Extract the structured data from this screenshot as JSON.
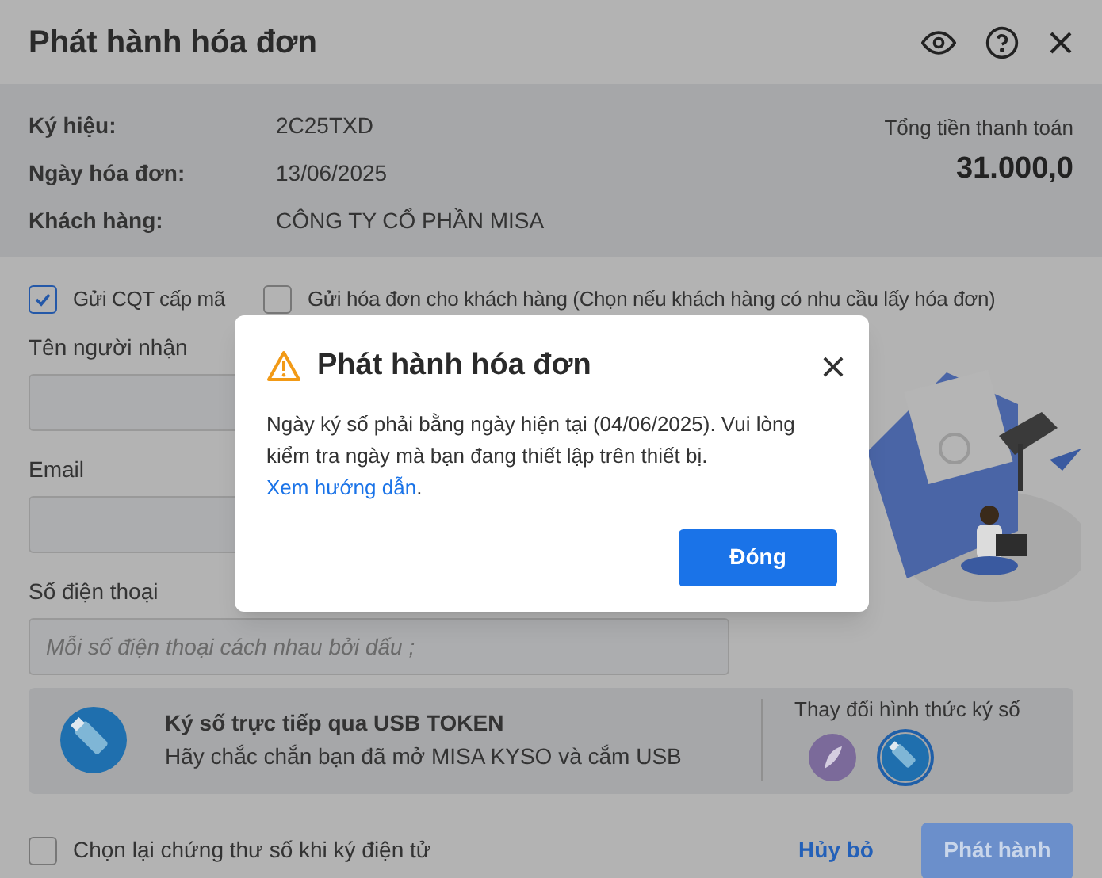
{
  "window": {
    "title": "Phát hành hóa đơn"
  },
  "info": {
    "rows": [
      {
        "label": "Ký hiệu:",
        "value": "2C25TXD"
      },
      {
        "label": "Ngày hóa đơn:",
        "value": "13/06/2025"
      },
      {
        "label": "Khách hàng:",
        "value": "CÔNG TY CỔ PHẦN MISA"
      }
    ],
    "total_label": "Tổng tiền thanh toán",
    "total_value": "31.000,0"
  },
  "options": [
    {
      "label": "Gửi CQT cấp mã",
      "checked": true
    },
    {
      "label": "Gửi hóa đơn cho khách hàng (Chọn nếu khách hàng có nhu cầu lấy hóa đơn)",
      "checked": false
    }
  ],
  "fields": [
    {
      "label": "Tên người nhận"
    },
    {
      "label": "Email"
    },
    {
      "label": "Số điện thoại",
      "placeholder": "Mỗi số điện thoại cách nhau bởi dấu ;"
    }
  ],
  "signing": {
    "title": "Ký số trực tiếp qua USB TOKEN",
    "subtitle": "Hãy chắc chắn bạn đã mở MISA KYSO và cắm USB",
    "change_label": "Thay đổi hình thức ký số",
    "methods": [
      {
        "kind": "pen",
        "selected": false
      },
      {
        "kind": "usb",
        "selected": true
      }
    ]
  },
  "reselect": {
    "label": "Chọn lại chứng thư số khi ký điện tử",
    "checked": false
  },
  "buttons": {
    "cancel": "Hủy bỏ",
    "issue": "Phát hành"
  },
  "alert": {
    "title": "Phát hành hóa đơn",
    "message": "Ngày ký số phải bằng ngày hiện tại (04/06/2025). Vui lòng kiểm tra ngày mà bạn đang thiết lập trên thiết bị.",
    "link": "Xem hướng dẫn",
    "link_suffix": ".",
    "button": "Đóng"
  }
}
